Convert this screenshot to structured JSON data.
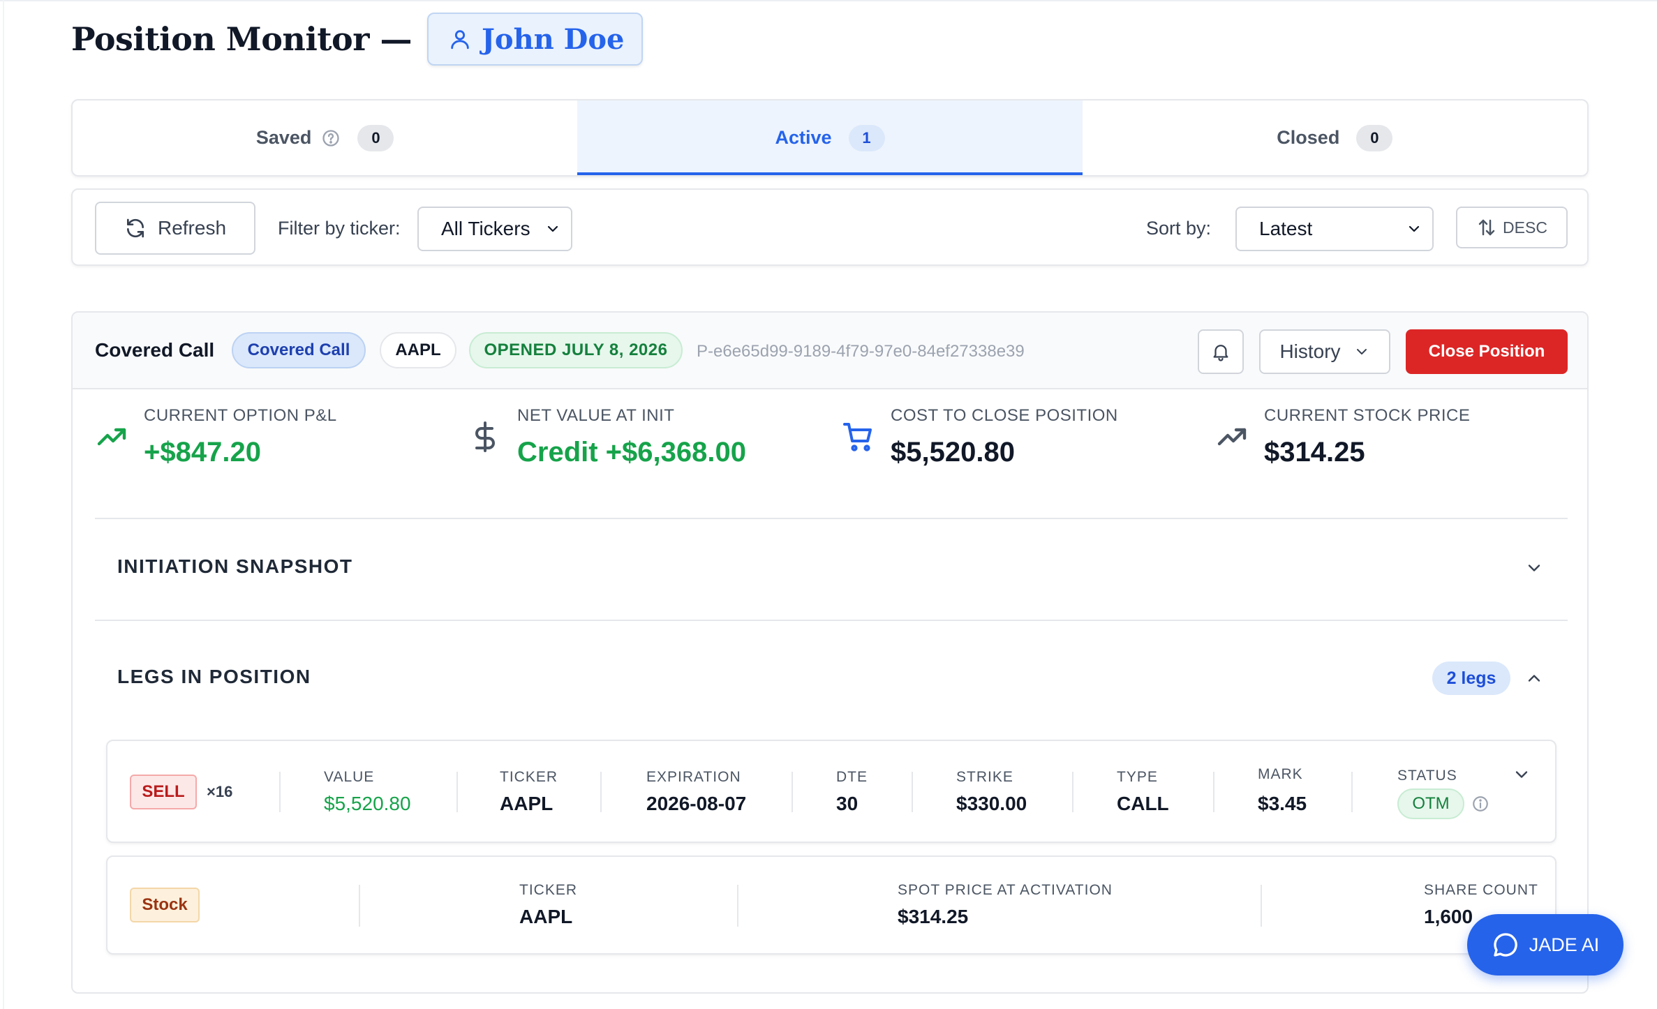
{
  "header": {
    "title": "Position Monitor —",
    "user_name": "John Doe"
  },
  "tabs": [
    {
      "label": "Saved",
      "count": "0",
      "active": false
    },
    {
      "label": "Active",
      "count": "1",
      "active": true
    },
    {
      "label": "Closed",
      "count": "0",
      "active": false
    }
  ],
  "toolbar": {
    "refresh_label": "Refresh",
    "filter_label": "Filter by ticker:",
    "ticker_filter_value": "All Tickers",
    "sort_label": "Sort by:",
    "sort_value": "Latest",
    "order_label": "DESC"
  },
  "position": {
    "strategy_name": "Covered Call",
    "strategy_badge": "Covered Call",
    "ticker_badge": "AAPL",
    "opened_badge": "OPENED JULY 8, 2026",
    "position_id": "P-e6e65d99-9189-4f79-97e0-84ef27338e39",
    "history_label": "History",
    "close_label": "Close Position",
    "metrics": {
      "pnl": {
        "label": "CURRENT OPTION P&L",
        "value": "+$847.20"
      },
      "net_value": {
        "label": "NET VALUE AT INIT",
        "value": "Credit +$6,368.00"
      },
      "cost_to_close": {
        "label": "COST TO CLOSE POSITION",
        "value": "$5,520.80"
      },
      "stock_price": {
        "label": "CURRENT STOCK PRICE",
        "value": "$314.25"
      }
    },
    "snapshot_title": "INITIATION SNAPSHOT",
    "legs_title": "LEGS IN POSITION",
    "legs_badge": "2 legs",
    "option_leg": {
      "side": "SELL",
      "quantity": "×16",
      "value_label": "VALUE",
      "value": "$5,520.80",
      "ticker_label": "TICKER",
      "ticker": "AAPL",
      "expiration_label": "EXPIRATION",
      "expiration": "2026-08-07",
      "dte_label": "DTE",
      "dte": "30",
      "strike_label": "STRIKE",
      "strike": "$330.00",
      "type_label": "TYPE",
      "type": "CALL",
      "mark_label": "MARK",
      "mark": "$3.45",
      "status_label": "STATUS",
      "status": "OTM"
    },
    "stock_leg": {
      "tag": "Stock",
      "ticker_label": "TICKER",
      "ticker": "AAPL",
      "spot_label": "SPOT PRICE AT ACTIVATION",
      "spot": "$314.25",
      "shares_label": "SHARE COUNT",
      "shares": "1,600"
    }
  },
  "assistant": {
    "label": "JADE AI"
  },
  "colors": {
    "accent": "#2563eb",
    "positive": "#16a34a",
    "danger": "#dc2626"
  }
}
